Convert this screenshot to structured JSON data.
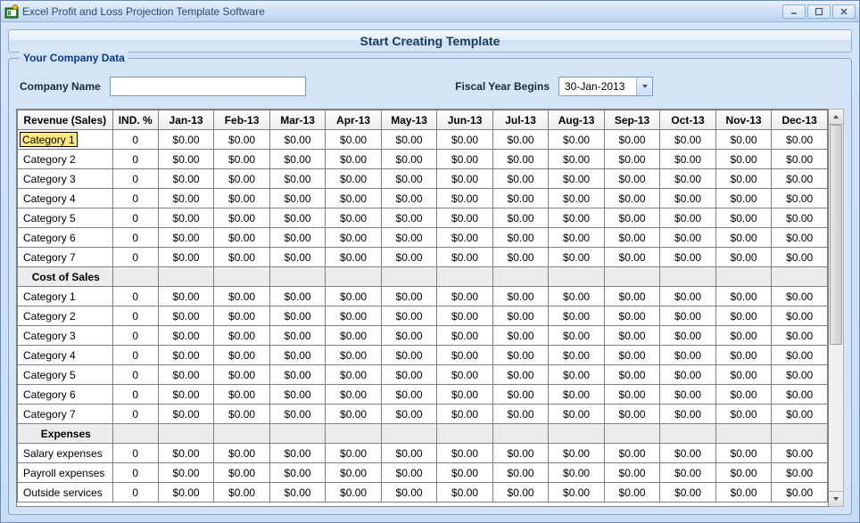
{
  "window": {
    "title": "Excel Profit and Loss Projection Template Software"
  },
  "main_button": "Start Creating Template",
  "fieldset": {
    "legend": "Your Company Data",
    "company_name_label": "Company Name",
    "company_name_value": "",
    "fiscal_label": "Fiscal Year Begins",
    "fiscal_value": "30-Jan-2013"
  },
  "grid": {
    "columns": [
      "Revenue (Sales)",
      "IND. %",
      "Jan-13",
      "Feb-13",
      "Mar-13",
      "Apr-13",
      "May-13",
      "Jun-13",
      "Jul-13",
      "Aug-13",
      "Sep-13",
      "Oct-13",
      "Nov-13",
      "Dec-13"
    ],
    "rows": [
      {
        "type": "data",
        "editing": true,
        "label": "Category 1",
        "ind": "0",
        "vals": [
          "$0.00",
          "$0.00",
          "$0.00",
          "$0.00",
          "$0.00",
          "$0.00",
          "$0.00",
          "$0.00",
          "$0.00",
          "$0.00",
          "$0.00",
          "$0.00"
        ]
      },
      {
        "type": "data",
        "label": "Category 2",
        "ind": "0",
        "vals": [
          "$0.00",
          "$0.00",
          "$0.00",
          "$0.00",
          "$0.00",
          "$0.00",
          "$0.00",
          "$0.00",
          "$0.00",
          "$0.00",
          "$0.00",
          "$0.00"
        ]
      },
      {
        "type": "data",
        "label": "Category 3",
        "ind": "0",
        "vals": [
          "$0.00",
          "$0.00",
          "$0.00",
          "$0.00",
          "$0.00",
          "$0.00",
          "$0.00",
          "$0.00",
          "$0.00",
          "$0.00",
          "$0.00",
          "$0.00"
        ]
      },
      {
        "type": "data",
        "label": "Category 4",
        "ind": "0",
        "vals": [
          "$0.00",
          "$0.00",
          "$0.00",
          "$0.00",
          "$0.00",
          "$0.00",
          "$0.00",
          "$0.00",
          "$0.00",
          "$0.00",
          "$0.00",
          "$0.00"
        ]
      },
      {
        "type": "data",
        "label": "Category 5",
        "ind": "0",
        "vals": [
          "$0.00",
          "$0.00",
          "$0.00",
          "$0.00",
          "$0.00",
          "$0.00",
          "$0.00",
          "$0.00",
          "$0.00",
          "$0.00",
          "$0.00",
          "$0.00"
        ]
      },
      {
        "type": "data",
        "label": "Category 6",
        "ind": "0",
        "vals": [
          "$0.00",
          "$0.00",
          "$0.00",
          "$0.00",
          "$0.00",
          "$0.00",
          "$0.00",
          "$0.00",
          "$0.00",
          "$0.00",
          "$0.00",
          "$0.00"
        ]
      },
      {
        "type": "data",
        "label": "Category 7",
        "ind": "0",
        "vals": [
          "$0.00",
          "$0.00",
          "$0.00",
          "$0.00",
          "$0.00",
          "$0.00",
          "$0.00",
          "$0.00",
          "$0.00",
          "$0.00",
          "$0.00",
          "$0.00"
        ]
      },
      {
        "type": "section",
        "label": "Cost of Sales"
      },
      {
        "type": "data",
        "label": "Category 1",
        "ind": "0",
        "vals": [
          "$0.00",
          "$0.00",
          "$0.00",
          "$0.00",
          "$0.00",
          "$0.00",
          "$0.00",
          "$0.00",
          "$0.00",
          "$0.00",
          "$0.00",
          "$0.00"
        ]
      },
      {
        "type": "data",
        "label": "Category 2",
        "ind": "0",
        "vals": [
          "$0.00",
          "$0.00",
          "$0.00",
          "$0.00",
          "$0.00",
          "$0.00",
          "$0.00",
          "$0.00",
          "$0.00",
          "$0.00",
          "$0.00",
          "$0.00"
        ]
      },
      {
        "type": "data",
        "label": "Category 3",
        "ind": "0",
        "vals": [
          "$0.00",
          "$0.00",
          "$0.00",
          "$0.00",
          "$0.00",
          "$0.00",
          "$0.00",
          "$0.00",
          "$0.00",
          "$0.00",
          "$0.00",
          "$0.00"
        ]
      },
      {
        "type": "data",
        "label": "Category 4",
        "ind": "0",
        "vals": [
          "$0.00",
          "$0.00",
          "$0.00",
          "$0.00",
          "$0.00",
          "$0.00",
          "$0.00",
          "$0.00",
          "$0.00",
          "$0.00",
          "$0.00",
          "$0.00"
        ]
      },
      {
        "type": "data",
        "label": "Category 5",
        "ind": "0",
        "vals": [
          "$0.00",
          "$0.00",
          "$0.00",
          "$0.00",
          "$0.00",
          "$0.00",
          "$0.00",
          "$0.00",
          "$0.00",
          "$0.00",
          "$0.00",
          "$0.00"
        ]
      },
      {
        "type": "data",
        "label": "Category 6",
        "ind": "0",
        "vals": [
          "$0.00",
          "$0.00",
          "$0.00",
          "$0.00",
          "$0.00",
          "$0.00",
          "$0.00",
          "$0.00",
          "$0.00",
          "$0.00",
          "$0.00",
          "$0.00"
        ]
      },
      {
        "type": "data",
        "label": "Category 7",
        "ind": "0",
        "vals": [
          "$0.00",
          "$0.00",
          "$0.00",
          "$0.00",
          "$0.00",
          "$0.00",
          "$0.00",
          "$0.00",
          "$0.00",
          "$0.00",
          "$0.00",
          "$0.00"
        ]
      },
      {
        "type": "section",
        "label": "Expenses"
      },
      {
        "type": "data",
        "label": "Salary expenses",
        "ind": "0",
        "vals": [
          "$0.00",
          "$0.00",
          "$0.00",
          "$0.00",
          "$0.00",
          "$0.00",
          "$0.00",
          "$0.00",
          "$0.00",
          "$0.00",
          "$0.00",
          "$0.00"
        ]
      },
      {
        "type": "data",
        "label": "Payroll expenses",
        "ind": "0",
        "vals": [
          "$0.00",
          "$0.00",
          "$0.00",
          "$0.00",
          "$0.00",
          "$0.00",
          "$0.00",
          "$0.00",
          "$0.00",
          "$0.00",
          "$0.00",
          "$0.00"
        ]
      },
      {
        "type": "data",
        "label": "Outside services",
        "ind": "0",
        "vals": [
          "$0.00",
          "$0.00",
          "$0.00",
          "$0.00",
          "$0.00",
          "$0.00",
          "$0.00",
          "$0.00",
          "$0.00",
          "$0.00",
          "$0.00",
          "$0.00"
        ]
      }
    ]
  }
}
